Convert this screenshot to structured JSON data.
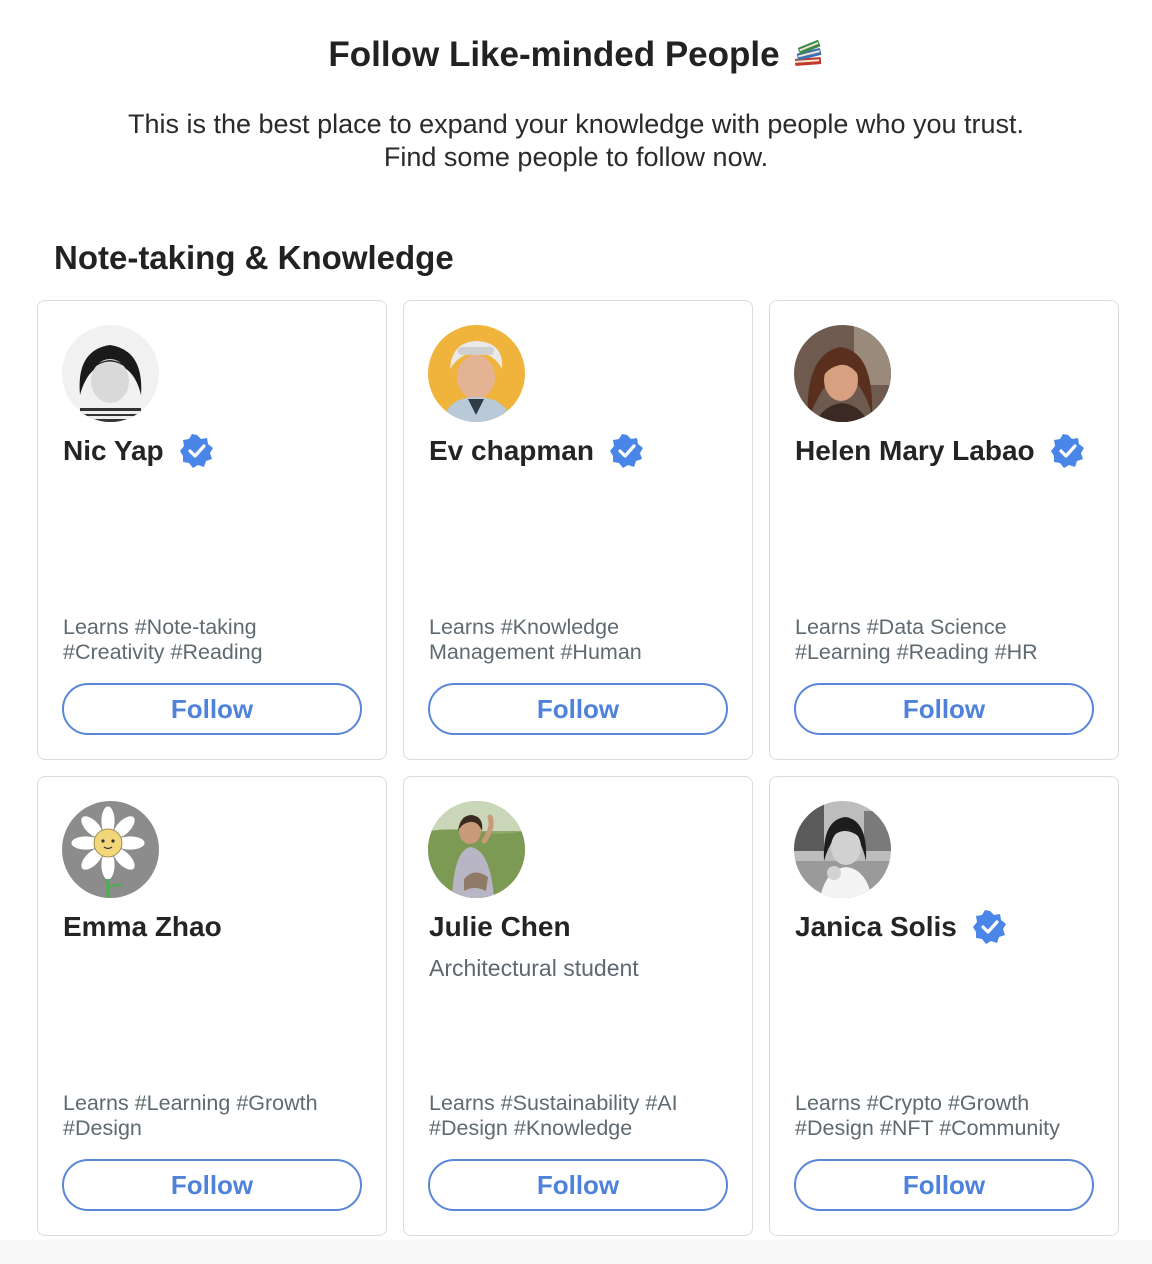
{
  "header": {
    "title": "Follow Like-minded People",
    "title_icon": "books-icon",
    "subtitle_line1": "This is the best place to expand your knowledge with people who you trust.",
    "subtitle_line2": "Find some people to follow now."
  },
  "section": {
    "title": "Note-taking & Knowledge"
  },
  "colors": {
    "accent": "#4f82da",
    "verified": "#4a86e8",
    "card_border": "#dcdcdc",
    "muted_text": "#5f6a70"
  },
  "cards": [
    {
      "name": "Nic Yap",
      "verified": true,
      "bio": "",
      "tags_line1": "Learns #Note-taking",
      "tags_line2": "#Creativity #Reading",
      "follow_label": "Follow",
      "avatar_icon": "avatar-photo"
    },
    {
      "name": "Ev chapman",
      "verified": true,
      "bio": "",
      "tags_line1": "Learns #Knowledge",
      "tags_line2": "Management #Human",
      "follow_label": "Follow",
      "avatar_icon": "avatar-photo"
    },
    {
      "name": "Helen Mary Labao",
      "verified": true,
      "bio": "",
      "tags_line1": "Learns #Data Science",
      "tags_line2": "#Learning #Reading #HR",
      "follow_label": "Follow",
      "avatar_icon": "avatar-photo"
    },
    {
      "name": "Emma Zhao",
      "verified": false,
      "bio": "",
      "tags_line1": "Learns #Learning #Growth",
      "tags_line2": "#Design",
      "follow_label": "Follow",
      "avatar_icon": "daisy-avatar"
    },
    {
      "name": "Julie Chen",
      "verified": false,
      "bio": "Architectural student",
      "tags_line1": "Learns #Sustainability #AI",
      "tags_line2": "#Design #Knowledge",
      "follow_label": "Follow",
      "avatar_icon": "avatar-photo"
    },
    {
      "name": "Janica Solis",
      "verified": true,
      "bio": "",
      "tags_line1": "Learns #Crypto #Growth",
      "tags_line2": "#Design #NFT #Community",
      "follow_label": "Follow",
      "avatar_icon": "avatar-photo"
    }
  ]
}
